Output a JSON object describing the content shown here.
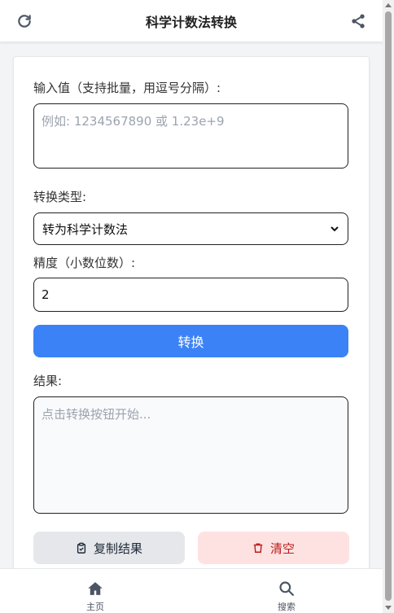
{
  "header": {
    "title": "科学计数法转换",
    "left_icon": "refresh-icon",
    "right_icon": "share-icon"
  },
  "form": {
    "input_label": "输入值（支持批量，用逗号分隔）:",
    "input_placeholder": "例如: 1234567890 或 1.23e+9",
    "input_value": "",
    "type_label": "转换类型:",
    "type_selected": "转为科学计数法",
    "precision_label": "精度（小数位数）:",
    "precision_value": "2",
    "convert_label": "转换",
    "result_label": "结果:",
    "result_placeholder": "点击转换按钮开始...",
    "copy_label": "复制结果",
    "clear_label": "清空"
  },
  "nav": {
    "home_label": "主页",
    "search_label": "搜索"
  },
  "colors": {
    "primary": "#3b82f6",
    "danger_bg": "#fee2e2",
    "danger_text": "#b91c1c"
  }
}
